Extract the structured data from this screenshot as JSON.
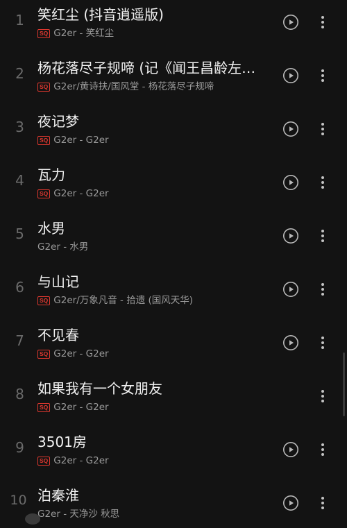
{
  "sq_label": "SQ",
  "accent_color": "#e0382f",
  "songs": [
    {
      "index": "1",
      "title": "笑红尘 (抖音逍遥版)",
      "subtitle": "G2er - 笑红尘",
      "sq": true,
      "play_icon": true
    },
    {
      "index": "2",
      "title": "杨花落尽子规啼 (记《闻王昌龄左迁龙标遥有此寄》)",
      "subtitle": "G2er/黄诗扶/国风堂 - 杨花落尽子规啼",
      "sq": true,
      "play_icon": true
    },
    {
      "index": "3",
      "title": "夜记梦",
      "subtitle": "G2er - G2er",
      "sq": true,
      "play_icon": true
    },
    {
      "index": "4",
      "title": "瓦力",
      "subtitle": "G2er - G2er",
      "sq": true,
      "play_icon": true
    },
    {
      "index": "5",
      "title": "水男",
      "subtitle": "G2er - 水男",
      "sq": false,
      "play_icon": true
    },
    {
      "index": "6",
      "title": "与山记",
      "subtitle": "G2er/万象凡音 - 拾遗 (国风天华)",
      "sq": true,
      "play_icon": true
    },
    {
      "index": "7",
      "title": "不见春",
      "subtitle": "G2er - G2er",
      "sq": true,
      "play_icon": true
    },
    {
      "index": "8",
      "title": "如果我有一个女朋友",
      "subtitle": "G2er - G2er",
      "sq": true,
      "play_icon": false
    },
    {
      "index": "9",
      "title": "3501房",
      "subtitle": "G2er - G2er",
      "sq": true,
      "play_icon": true
    },
    {
      "index": "10",
      "title": "泊秦淮",
      "subtitle": "G2er - 天净沙 秋思",
      "sq": false,
      "play_icon": true
    }
  ]
}
